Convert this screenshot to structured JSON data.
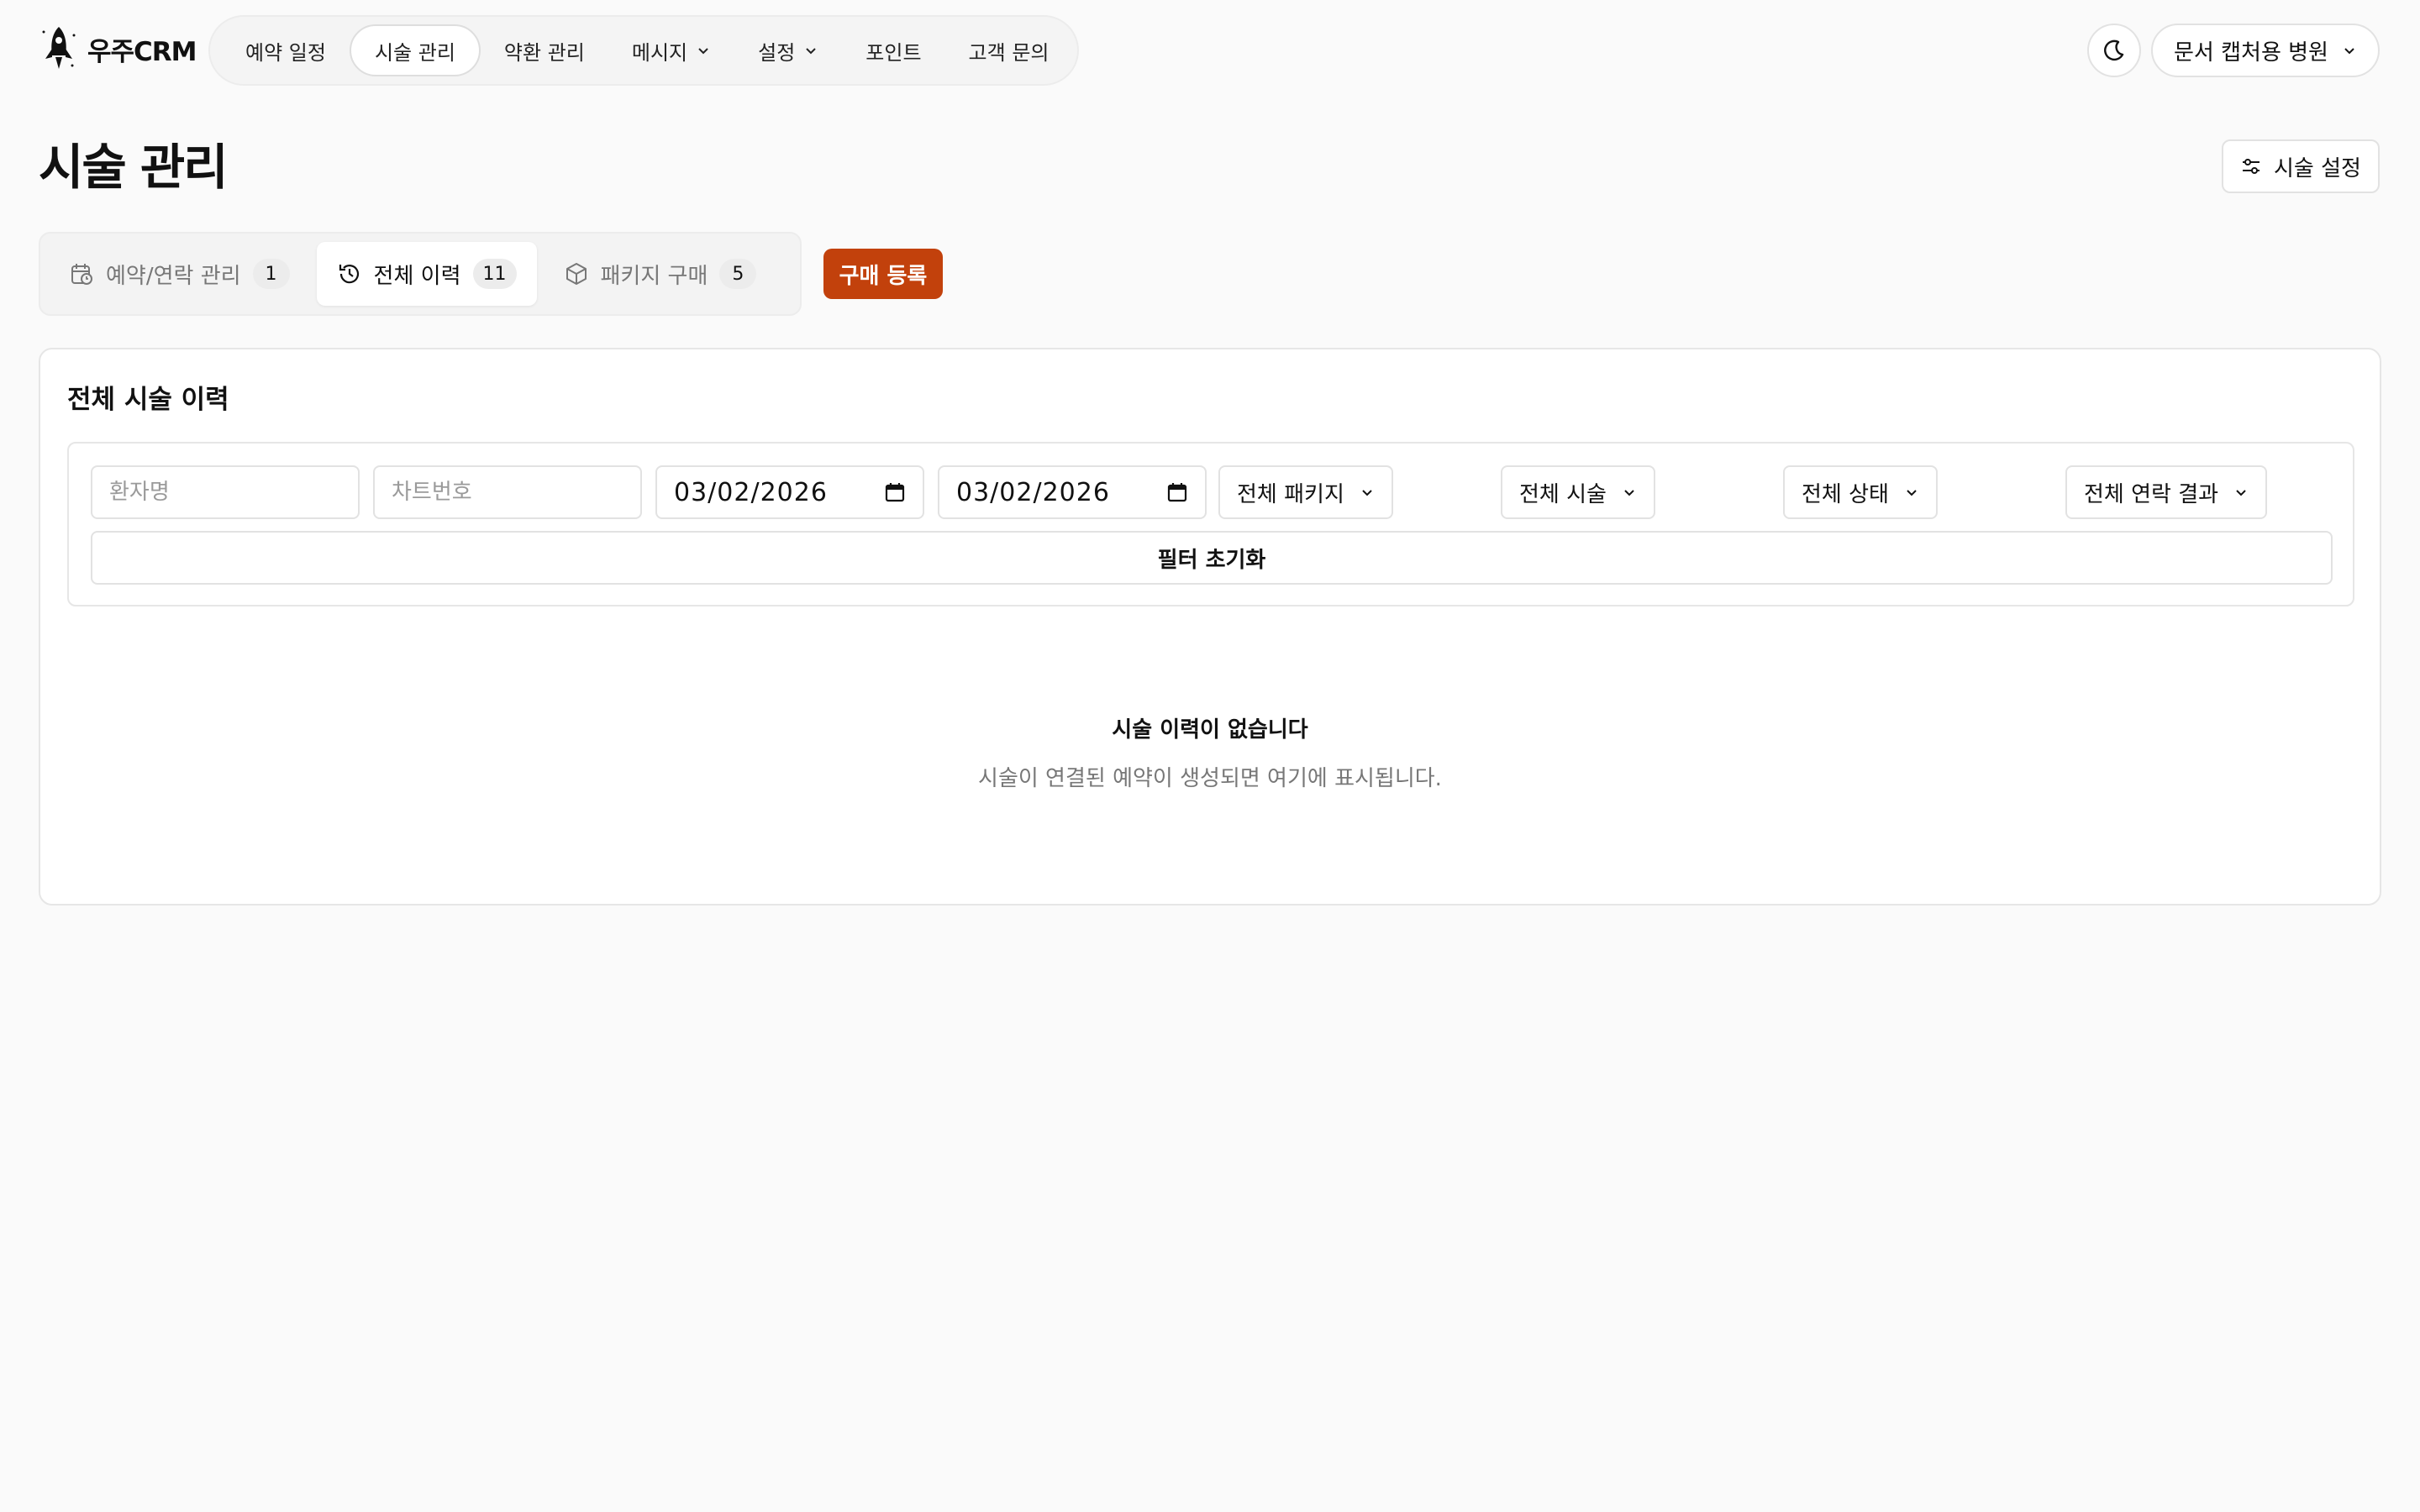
{
  "brand": {
    "name": "우주CRM"
  },
  "nav": {
    "items": [
      {
        "label": "예약 일정"
      },
      {
        "label": "시술 관리"
      },
      {
        "label": "약환 관리"
      },
      {
        "label": "메시지"
      },
      {
        "label": "설정"
      },
      {
        "label": "포인트"
      },
      {
        "label": "고객 문의"
      }
    ]
  },
  "header": {
    "clinic_label": "문서 캡처용 병원"
  },
  "page": {
    "title": "시술 관리",
    "settings_label": "시술 설정"
  },
  "tabs": [
    {
      "label": "예약/연락 관리",
      "count": "1"
    },
    {
      "label": "전체 이력",
      "count": "11"
    },
    {
      "label": "패키지 구매",
      "count": "5"
    }
  ],
  "buy_button": "구매 등록",
  "card": {
    "title": "전체 시술 이력",
    "filters": {
      "patient_placeholder": "환자명",
      "chart_placeholder": "차트번호",
      "date_from": "03/02/2026",
      "date_to": "03/02/2026",
      "package": "전체 패키지",
      "procedure": "전체 시술",
      "status": "전체 상태",
      "contact_result": "전체 연락 결과",
      "reset_label": "필터 초기화"
    },
    "empty": {
      "title": "시술 이력이 없습니다",
      "subtitle": "시술이 연결된 예약이 생성되면 여기에 표시됩니다."
    }
  },
  "colors": {
    "accent": "#c2410c",
    "background": "#fafafa"
  }
}
